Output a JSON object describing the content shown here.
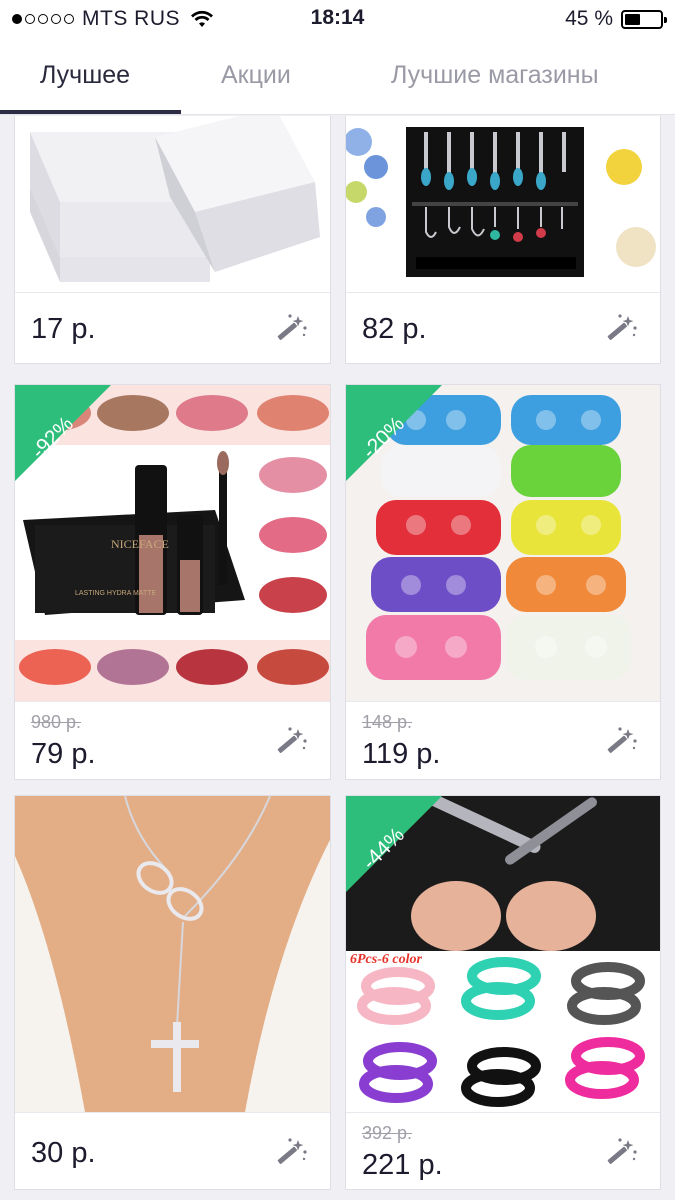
{
  "status_bar": {
    "carrier": "MTS RUS",
    "time": "18:14",
    "battery": "45 %",
    "battery_level": 0.45,
    "signal_bars": 1
  },
  "tabs": [
    {
      "label": "Лучшее",
      "active": true
    },
    {
      "label": "Акции",
      "active": false
    },
    {
      "label": "Лучшие магазины",
      "active": false
    }
  ],
  "products": [
    {
      "price": "17 р.",
      "old_price": "",
      "discount": "",
      "image": "white-sponges"
    },
    {
      "price": "82 р.",
      "old_price": "",
      "discount": "",
      "image": "earrings-stand"
    },
    {
      "price": "79 р.",
      "old_price": "980 р.",
      "discount": "-92%",
      "image": "lipstick-set",
      "image_text": "NICEFACE",
      "image_caption": "LASTING HYDRA MATTE"
    },
    {
      "price": "119 р.",
      "old_price": "148 р.",
      "discount": "-20%",
      "image": "foam-roses"
    },
    {
      "price": "30 р.",
      "old_price": "",
      "discount": "",
      "image": "infinity-cross-necklace"
    },
    {
      "price": "221 р.",
      "old_price": "392 р.",
      "discount": "-44%",
      "image": "silicone-rings",
      "image_text": "6Pcs-6 color"
    }
  ],
  "colors": {
    "badge": "#2dbe7b",
    "active_tab": "#2a2a3d",
    "inactive_tab": "#9a9aa6",
    "indicator": "#2c2c44"
  }
}
